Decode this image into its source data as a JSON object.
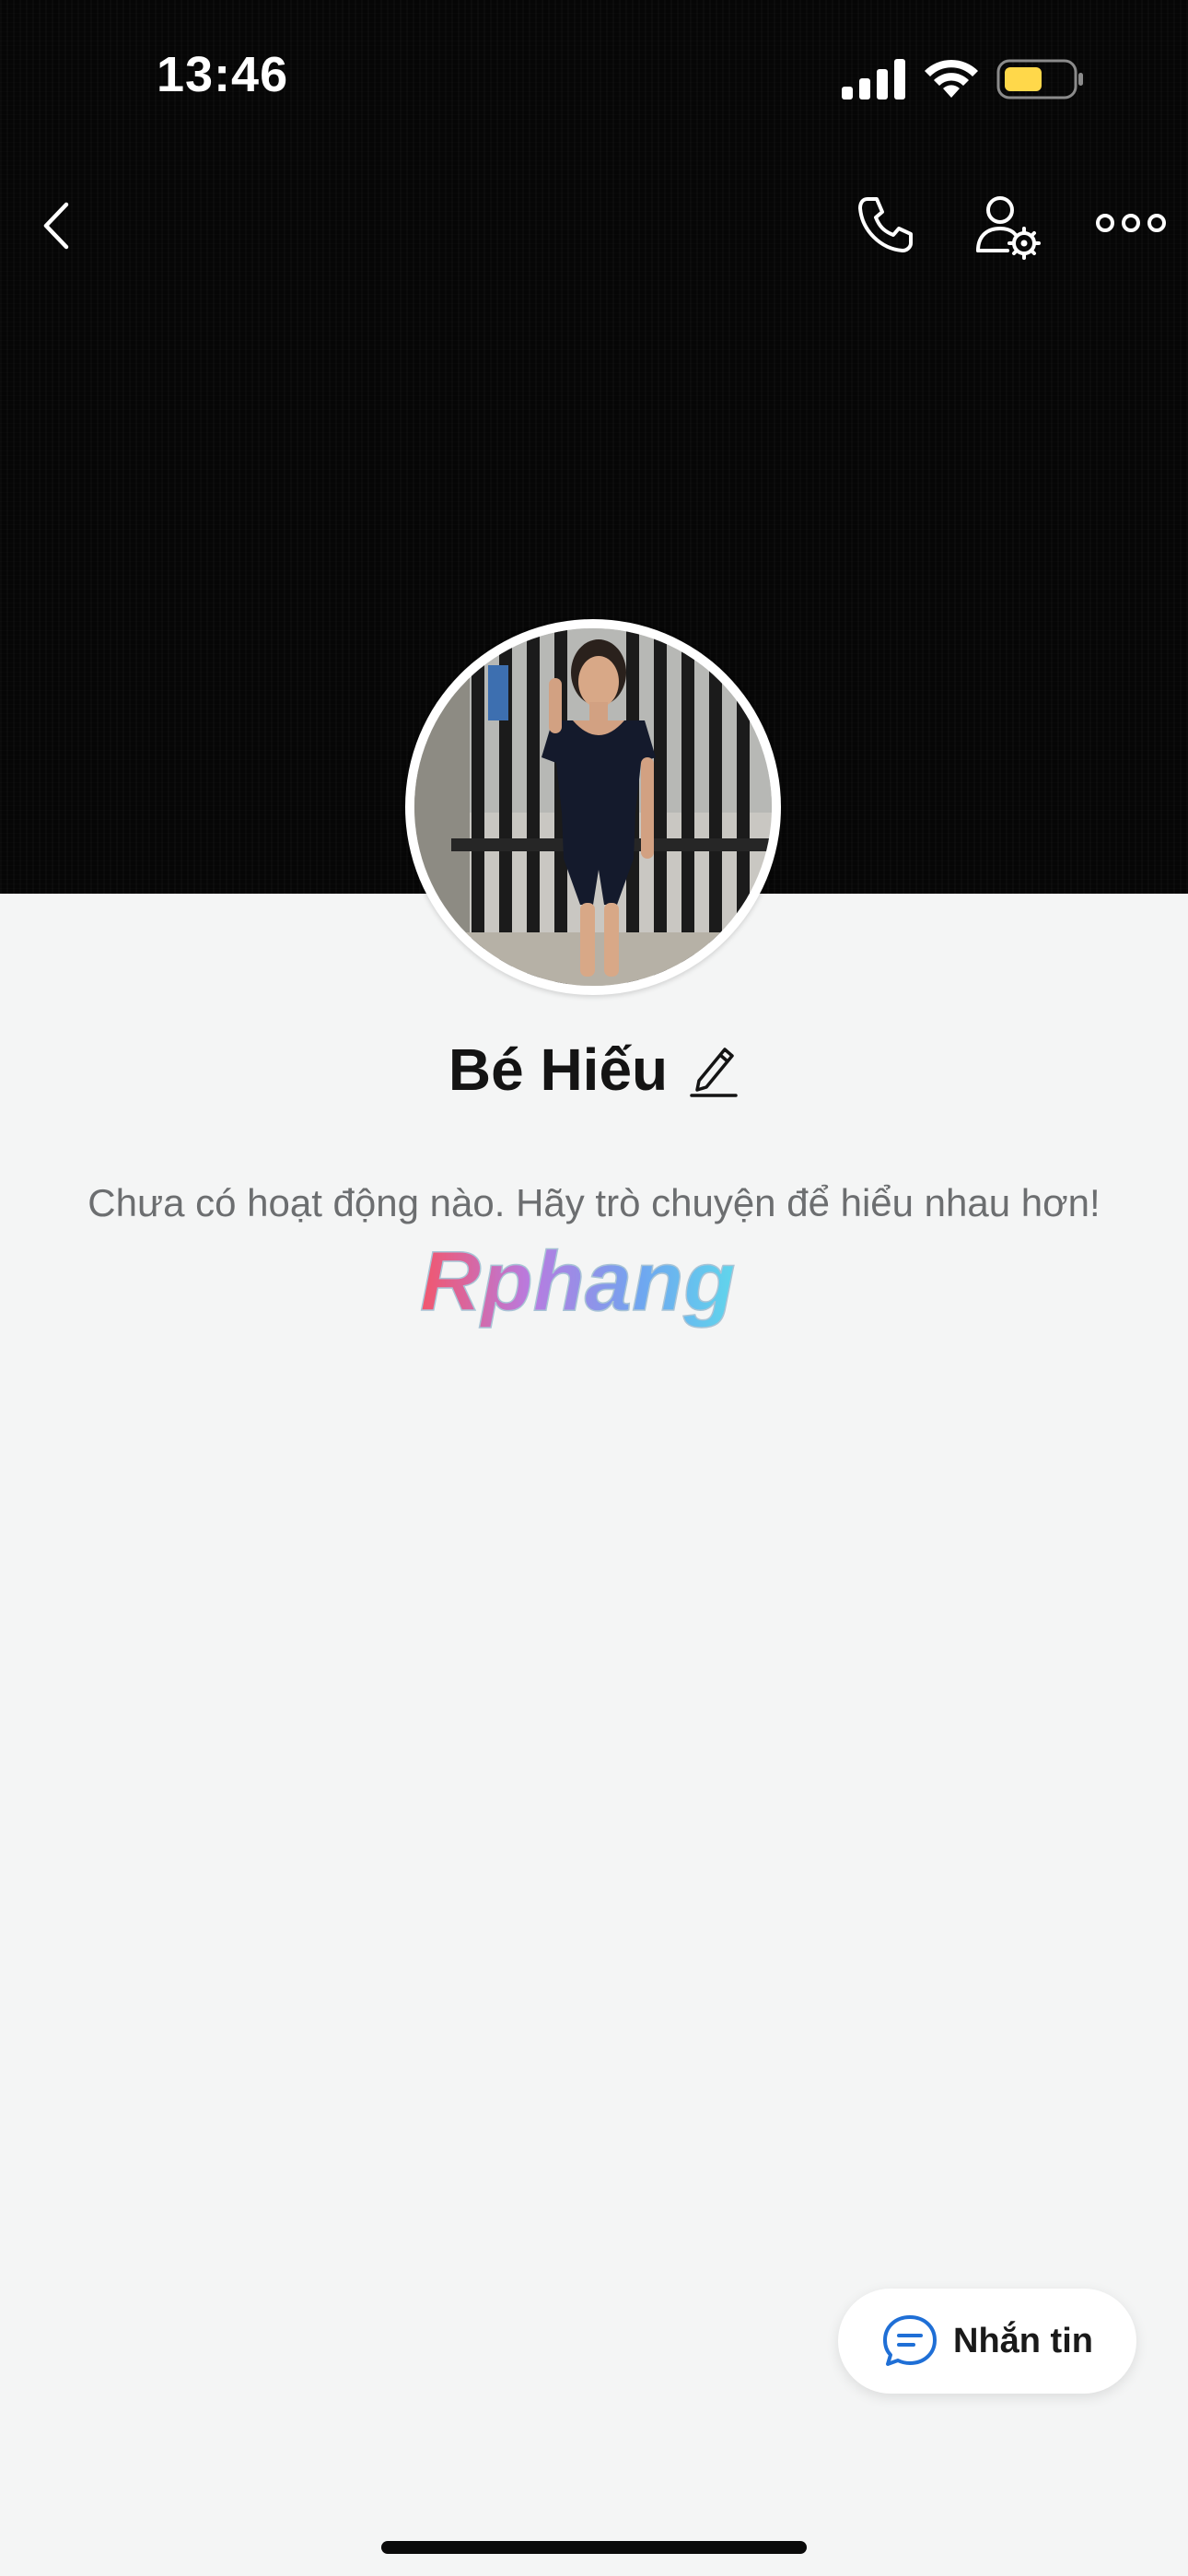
{
  "status_bar": {
    "time": "13:46",
    "icons": [
      "signal-icon",
      "wifi-icon",
      "battery-icon"
    ],
    "battery_color": "#FFD84A"
  },
  "nav": {
    "icons": [
      "back-icon",
      "phone-icon",
      "user-settings-icon",
      "more-icon"
    ]
  },
  "profile": {
    "name": "Bé Hiếu",
    "edit_icon": "pencil-icon",
    "activity_text": "Chưa có hoạt động nào. Hãy trò chuyện để hiểu nhau hơn!"
  },
  "watermark": {
    "text": "Rphang"
  },
  "message_button": {
    "label": "Nhắn tin",
    "icon": "chat-bubble-icon",
    "icon_color": "#1F6FD6"
  },
  "colors": {
    "cover": "#060606",
    "background": "#F4F5F5",
    "name": "#141414",
    "subtext": "#6C6E70"
  }
}
